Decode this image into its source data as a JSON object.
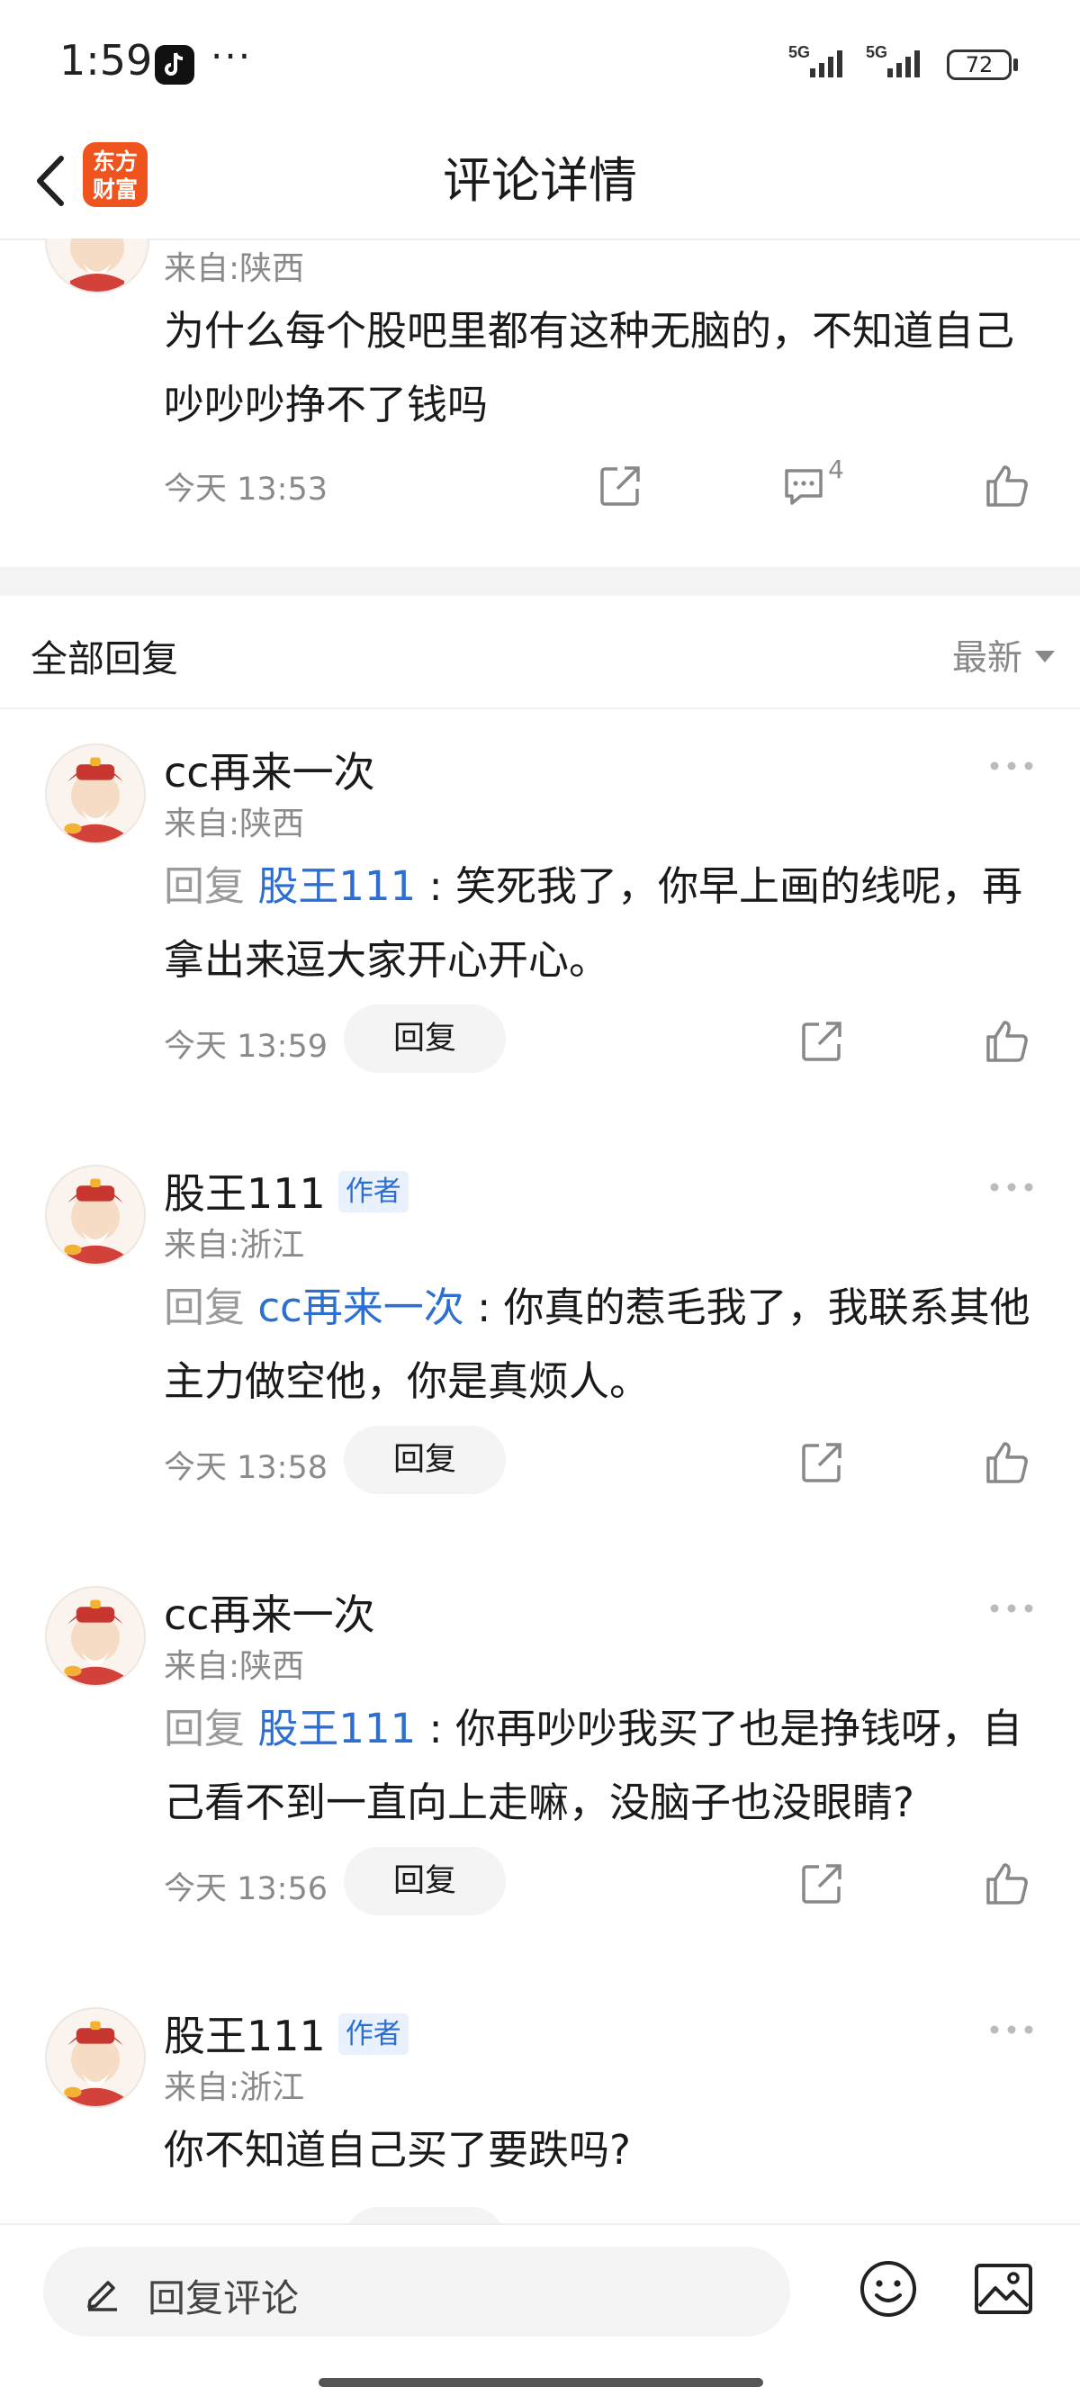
{
  "status_bar": {
    "time": "1:59",
    "more": "···",
    "signal1": "5G",
    "signal2": "5G",
    "battery": "72"
  },
  "header": {
    "title": "评论详情",
    "logo_line1": "东方",
    "logo_line2": "财富"
  },
  "original_comment": {
    "region": "来自:陕西",
    "content": "为什么每个股吧里都有这种无脑的，不知道自己吵吵吵挣不了钱吗",
    "time": "今天 13:53",
    "comment_count": "4"
  },
  "section": {
    "title": "全部回复",
    "sort_label": "最新"
  },
  "replies": [
    {
      "username": "cc再来一次",
      "badge": "",
      "region": "来自:陕西",
      "reply_prefix": "回复 ",
      "reply_to": "股王111",
      "separator": " : ",
      "text": "笑死我了，你早上画的线呢，再拿出来逗大家开心开心。",
      "time": "今天 13:59",
      "reply_button": "回复"
    },
    {
      "username": "股王111",
      "badge": "作者",
      "region": "来自:浙江",
      "reply_prefix": "回复 ",
      "reply_to": "cc再来一次",
      "separator": " : ",
      "text": "你真的惹毛我了，我联系其他主力做空他，你是真烦人。",
      "time": "今天 13:58",
      "reply_button": "回复"
    },
    {
      "username": "cc再来一次",
      "badge": "",
      "region": "来自:陕西",
      "reply_prefix": "回复 ",
      "reply_to": "股王111",
      "separator": " : ",
      "text": "你再吵吵我买了也是挣钱呀，自己看不到一直向上走嘛，没脑子也没眼睛?",
      "time": "今天 13:56",
      "reply_button": "回复"
    },
    {
      "username": "股王111",
      "badge": "作者",
      "region": "来自:浙江",
      "reply_prefix": "",
      "reply_to": "",
      "separator": "",
      "text": "你不知道自己买了要跌吗?",
      "time": "",
      "reply_button": ""
    }
  ],
  "bottom_bar": {
    "input_placeholder": "回复评论"
  },
  "colors": {
    "accent_blue": "#2d6fd1",
    "logo_orange": "#f0541e",
    "muted_gray": "#8a8a8a"
  }
}
